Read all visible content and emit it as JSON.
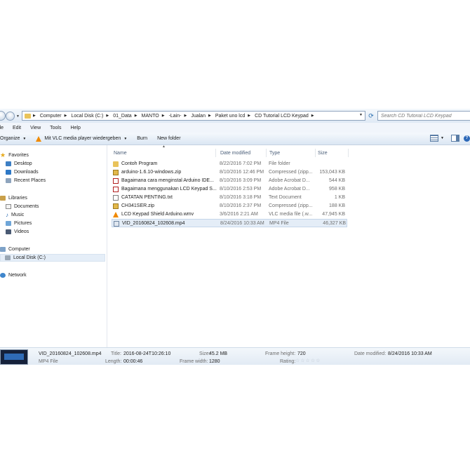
{
  "address": {
    "crumbs": [
      "Computer",
      "Local Disk (C:)",
      "01_Data",
      "MANTO",
      "-Lain-",
      "Jualan",
      "Paket uno lcd",
      "CD Tutorial LCD Keypad"
    ]
  },
  "search": {
    "placeholder": "Search CD Tutorial LCD Keypad"
  },
  "menu": [
    "ile",
    "Edit",
    "View",
    "Tools",
    "Help"
  ],
  "commands": {
    "organize": "Organize",
    "open_with": "Mit VLC media player wiedergeben",
    "burn": "Burn",
    "new_folder": "New folder"
  },
  "nav": {
    "favorites": "Favorites",
    "desktop": "Desktop",
    "downloads": "Downloads",
    "recent": "Recent Places",
    "libraries": "Libraries",
    "documents": "Documents",
    "music": "Music",
    "pictures": "Pictures",
    "videos": "Videos",
    "computer": "Computer",
    "local_disk": "Local Disk (C:)",
    "network": "Network"
  },
  "columns": {
    "name": "Name",
    "date": "Date modified",
    "type": "Type",
    "size": "Size"
  },
  "files": [
    {
      "name": "Contoh Program",
      "date": "8/22/2016 7:02 PM",
      "type": "File folder",
      "size": "",
      "icon": "folder-icon"
    },
    {
      "name": "arduino-1.6.10-windows.zip",
      "date": "8/10/2016 12:46 PM",
      "type": "Compressed (zipp...",
      "size": "153,043 KB",
      "icon": "zip-icon"
    },
    {
      "name": "Bagaimana cara menginstal Arduino IDE...",
      "date": "8/10/2016 3:09 PM",
      "type": "Adobe Acrobat D...",
      "size": "544 KB",
      "icon": "pdf-icon"
    },
    {
      "name": "Bagaimana menggunakan LCD Keypad S...",
      "date": "8/10/2016 2:53 PM",
      "type": "Adobe Acrobat D...",
      "size": "958 KB",
      "icon": "pdf-icon"
    },
    {
      "name": "CATATAN PENTING.txt",
      "date": "8/10/2016 3:18 PM",
      "type": "Text Document",
      "size": "1 KB",
      "icon": "text-file-icon"
    },
    {
      "name": "CH341SER.zip",
      "date": "8/10/2016 2:37 PM",
      "type": "Compressed (zipp...",
      "size": "188 KB",
      "icon": "zip-icon"
    },
    {
      "name": "LCD Keypad Shield Arduino.wmv",
      "date": "3/6/2016 2:21 AM",
      "type": "VLC media file (.w...",
      "size": "47,945 KB",
      "icon": "vlc-icon"
    },
    {
      "name": "VID_20160824_102608.mp4",
      "date": "8/24/2016 10:33 AM",
      "type": "MP4 File",
      "size": "46,327 KB",
      "icon": "video-file-icon"
    }
  ],
  "details": {
    "name": "VID_20160824_102608.mp4",
    "type": "MP4 File",
    "title_label": "Title:",
    "title_value": "2016-08-24T10:26:10",
    "length_label": "Length:",
    "length_value": "00:00:46",
    "size_label": "Size:",
    "size_value": "45.2 MB",
    "frame_width_label": "Frame width:",
    "frame_width_value": "1280",
    "frame_height_label": "Frame height:",
    "frame_height_value": "720",
    "rating_label": "Rating:",
    "date_modified_label": "Date modified:",
    "date_modified_value": "8/24/2016 10:33 AM"
  },
  "colors": {
    "accent": "#2c68b8",
    "selection": "#e4edf7",
    "folder": "#e9c35a"
  }
}
